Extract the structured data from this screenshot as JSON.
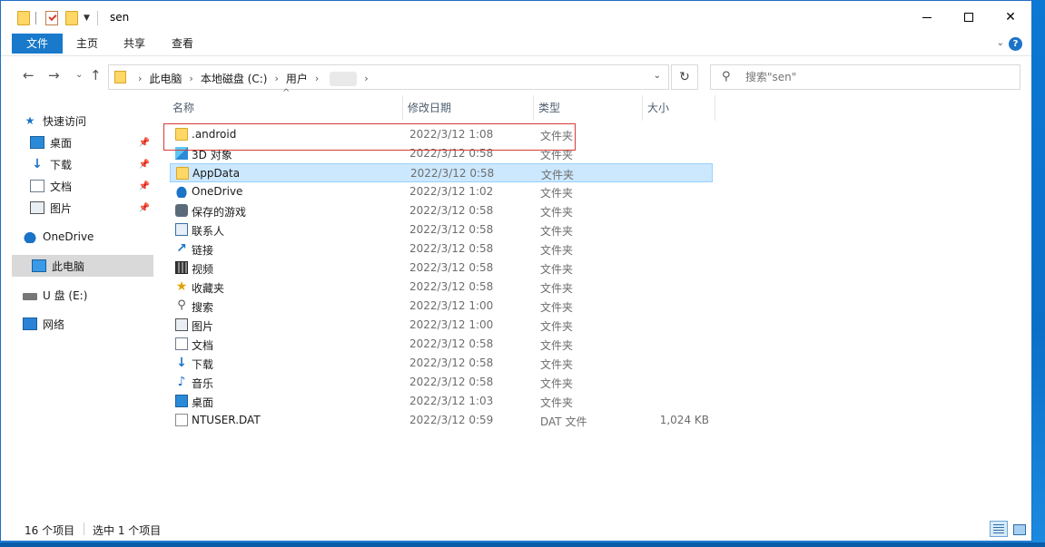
{
  "window": {
    "title": "sen",
    "controls": {
      "minimize": "—",
      "maximize": "☐",
      "close": "✕"
    }
  },
  "ribbon": {
    "tabs": [
      "文件",
      "主页",
      "共享",
      "查看"
    ],
    "collapse_icon": "chevron-down-icon",
    "help_label": "?"
  },
  "address": {
    "crumbs": [
      "此电脑",
      "本地磁盘 (C:)",
      "用户"
    ],
    "search_placeholder": "搜索\"sen\""
  },
  "nav": {
    "quick_access": "快速访问",
    "quick_items": [
      "桌面",
      "下载",
      "文档",
      "图片"
    ],
    "onedrive": "OneDrive",
    "this_pc": "此电脑",
    "usb": "U 盘 (E:)",
    "network": "网络"
  },
  "columns": {
    "name": "名称",
    "date": "修改日期",
    "type": "类型",
    "size": "大小"
  },
  "files": [
    {
      "name": ".android",
      "date": "2022/3/12 1:08",
      "type": "文件夹",
      "size": "",
      "icon": "folder-icon"
    },
    {
      "name": "3D 对象",
      "date": "2022/3/12 0:58",
      "type": "文件夹",
      "size": "",
      "icon": "3d-objects-icon"
    },
    {
      "name": "AppData",
      "date": "2022/3/12 0:58",
      "type": "文件夹",
      "size": "",
      "icon": "folder-icon"
    },
    {
      "name": "OneDrive",
      "date": "2022/3/12 1:02",
      "type": "文件夹",
      "size": "",
      "icon": "cloud-icon"
    },
    {
      "name": "保存的游戏",
      "date": "2022/3/12 0:58",
      "type": "文件夹",
      "size": "",
      "icon": "saved-games-icon"
    },
    {
      "name": "联系人",
      "date": "2022/3/12 0:58",
      "type": "文件夹",
      "size": "",
      "icon": "contacts-icon"
    },
    {
      "name": "链接",
      "date": "2022/3/12 0:58",
      "type": "文件夹",
      "size": "",
      "icon": "links-icon"
    },
    {
      "name": "视频",
      "date": "2022/3/12 0:58",
      "type": "文件夹",
      "size": "",
      "icon": "video-icon"
    },
    {
      "name": "收藏夹",
      "date": "2022/3/12 0:58",
      "type": "文件夹",
      "size": "",
      "icon": "favorites-icon"
    },
    {
      "name": "搜索",
      "date": "2022/3/12 1:00",
      "type": "文件夹",
      "size": "",
      "icon": "search-icon"
    },
    {
      "name": "图片",
      "date": "2022/3/12 1:00",
      "type": "文件夹",
      "size": "",
      "icon": "pictures-icon"
    },
    {
      "name": "文档",
      "date": "2022/3/12 0:58",
      "type": "文件夹",
      "size": "",
      "icon": "documents-icon"
    },
    {
      "name": "下载",
      "date": "2022/3/12 0:58",
      "type": "文件夹",
      "size": "",
      "icon": "downloads-icon"
    },
    {
      "name": "音乐",
      "date": "2022/3/12 0:58",
      "type": "文件夹",
      "size": "",
      "icon": "music-icon"
    },
    {
      "name": "桌面",
      "date": "2022/3/12 1:03",
      "type": "文件夹",
      "size": "",
      "icon": "desktop-icon"
    },
    {
      "name": "NTUSER.DAT",
      "date": "2022/3/12 0:59",
      "type": "DAT 文件",
      "size": "1,024 KB",
      "icon": "file-icon"
    }
  ],
  "status": {
    "count": "16 个项目",
    "selected": "选中 1 个项目"
  },
  "colors": {
    "accent": "#1979ca",
    "selection": "#cce8ff",
    "highlight_box": "#d63a36"
  }
}
